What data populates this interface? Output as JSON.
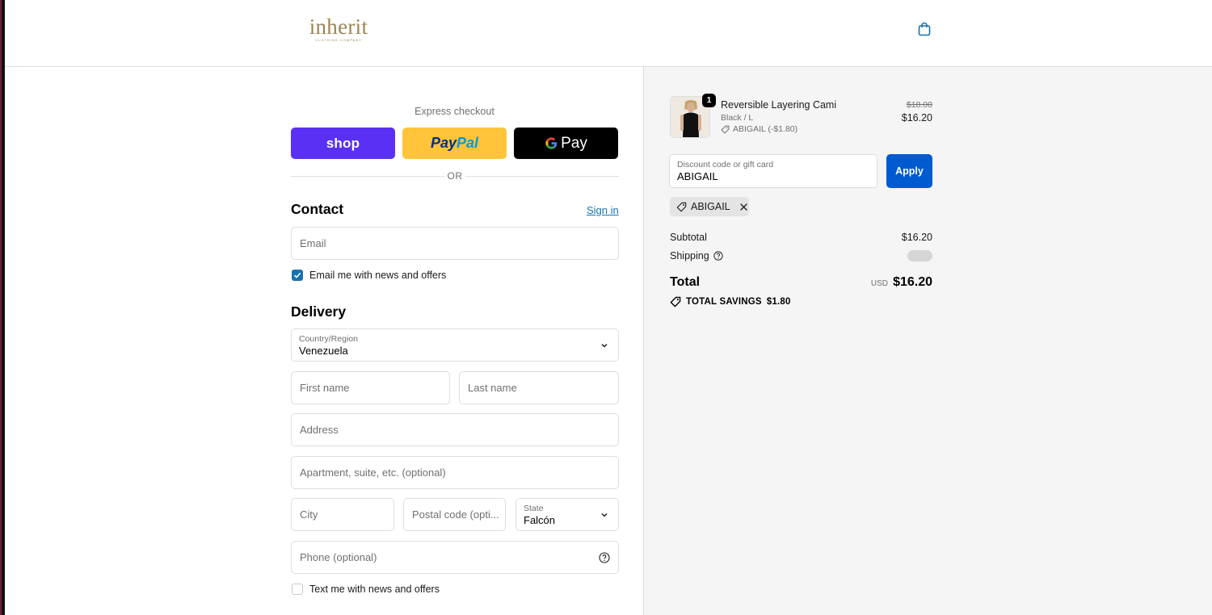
{
  "header": {
    "logo_text": "inherit",
    "logo_subtext": "CLOTHING COMPANY",
    "cart_icon": "shopping-bag-icon"
  },
  "express": {
    "title": "Express checkout",
    "shop_label": "shop",
    "paypal_part1": "Pay",
    "paypal_part2": "Pal",
    "gpay_label": "Pay",
    "or_text": "OR"
  },
  "contact": {
    "heading": "Contact",
    "signin_label": "Sign in",
    "email_placeholder": "Email",
    "email_news_label": "Email me with news and offers",
    "email_news_checked": true
  },
  "delivery": {
    "heading": "Delivery",
    "country_label": "Country/Region",
    "country_value": "Venezuela",
    "first_name_placeholder": "First name",
    "last_name_placeholder": "Last name",
    "address_placeholder": "Address",
    "apartment_placeholder": "Apartment, suite, etc. (optional)",
    "city_placeholder": "City",
    "postal_placeholder": "Postal code (opti...",
    "state_label": "State",
    "state_value": "Falcón",
    "phone_placeholder": "Phone (optional)",
    "text_news_label": "Text me with news and offers",
    "text_news_checked": false
  },
  "summary": {
    "item": {
      "quantity": "1",
      "name": "Reversible Layering Cami",
      "variant": "Black / L",
      "discount": "ABIGAIL (-$1.80)",
      "price_original": "$18.00",
      "price_final": "$16.20"
    },
    "discount_field_label": "Discount code or gift card",
    "discount_field_value": "ABIGAIL",
    "apply_label": "Apply",
    "applied_code": "ABIGAIL",
    "subtotal_label": "Subtotal",
    "subtotal_value": "$16.20",
    "shipping_label": "Shipping",
    "total_label": "Total",
    "total_currency": "USD",
    "total_value": "$16.20",
    "savings_label": "TOTAL SAVINGS",
    "savings_value": "$1.80"
  },
  "colors": {
    "shop_purple": "#5a31f4",
    "paypal_yellow": "#ffc439",
    "apply_blue": "#005bd1",
    "link_blue": "#1773b0",
    "logo_gold": "#9d8552"
  }
}
